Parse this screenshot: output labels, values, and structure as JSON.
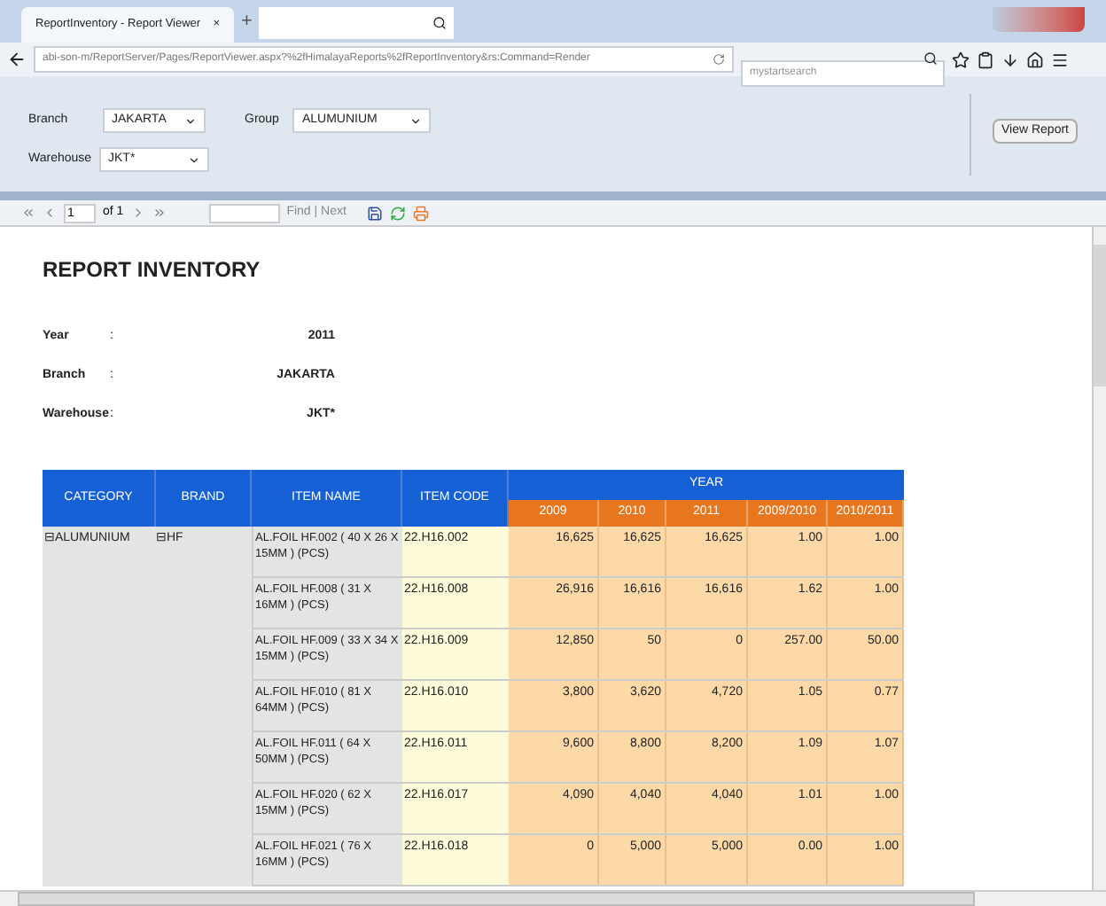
{
  "browser": {
    "tab_title": "ReportInventory - Report Viewer",
    "new_tab": "+",
    "close_tab": "×",
    "url": "abi-son-m/ReportServer/Pages/ReportViewer.aspx?%2fHimalayaReports%2fReportInventory&rs:Command=Render",
    "search_placeholder": "mystartsearch"
  },
  "parameters": [
    {
      "label": "Branch",
      "value": "JAKARTA"
    },
    {
      "label": "Group",
      "value": "ALUMUNIUM"
    },
    {
      "label": "Warehouse",
      "value": "JKT*"
    }
  ],
  "view_report_button": "View Report",
  "toolbar": {
    "page": "1",
    "of": "of 1",
    "find_next": "Find | Next"
  },
  "report": {
    "title": "REPORT INVENTORY",
    "info": [
      {
        "label": "Year",
        "sep": ":",
        "value": "2011"
      },
      {
        "label": "Branch",
        "sep": ":",
        "value": "JAKARTA"
      },
      {
        "label": "Warehouse",
        "sep": ":",
        "value": "JKT*"
      }
    ],
    "columns": [
      "CATEGORY",
      "BRAND",
      "ITEM NAME",
      "ITEM CODE"
    ],
    "year_group": "YEAR",
    "year_columns": [
      "2009",
      "2010",
      "2011",
      "2009/2010",
      "2010/2011"
    ],
    "category": "⊟ALUMUNIUM",
    "brand": "⊟HF",
    "rows": [
      {
        "name": "AL.FOIL HF.002 ( 40 X 26 X 15MM ) (PCS)",
        "code": "22.H16.002",
        "values": [
          "16,625",
          "16,625",
          "16,625",
          "1.00",
          "1.00"
        ]
      },
      {
        "name": "AL.FOIL HF.008 ( 31 X 16MM ) (PCS)",
        "code": "22.H16.008",
        "values": [
          "26,916",
          "16,616",
          "16,616",
          "1.62",
          "1.00"
        ]
      },
      {
        "name": "AL.FOIL HF.009 ( 33 X 34 X 15MM ) (PCS)",
        "code": "22.H16.009",
        "values": [
          "12,850",
          "50",
          "0",
          "257.00",
          "50.00"
        ]
      },
      {
        "name": "AL.FOIL HF.010 ( 81 X 64MM ) (PCS)",
        "code": "22.H16.010",
        "values": [
          "3,800",
          "3,620",
          "4,720",
          "1.05",
          "0.77"
        ]
      },
      {
        "name": "AL.FOIL HF.011 ( 64 X 50MM ) (PCS)",
        "code": "22.H16.011",
        "values": [
          "9,600",
          "8,800",
          "8,200",
          "1.09",
          "1.07"
        ]
      },
      {
        "name": "AL.FOIL HF.020 ( 62 X 15MM ) (PCS)",
        "code": "22.H16.017",
        "values": [
          "4,090",
          "4,040",
          "4,040",
          "1.01",
          "1.00"
        ]
      },
      {
        "name": "AL.FOIL HF.021 ( 76 X 16MM ) (PCS)",
        "code": "22.H16.018",
        "values": [
          "0",
          "5,000",
          "5,000",
          "0.00",
          "1.00"
        ]
      }
    ]
  }
}
